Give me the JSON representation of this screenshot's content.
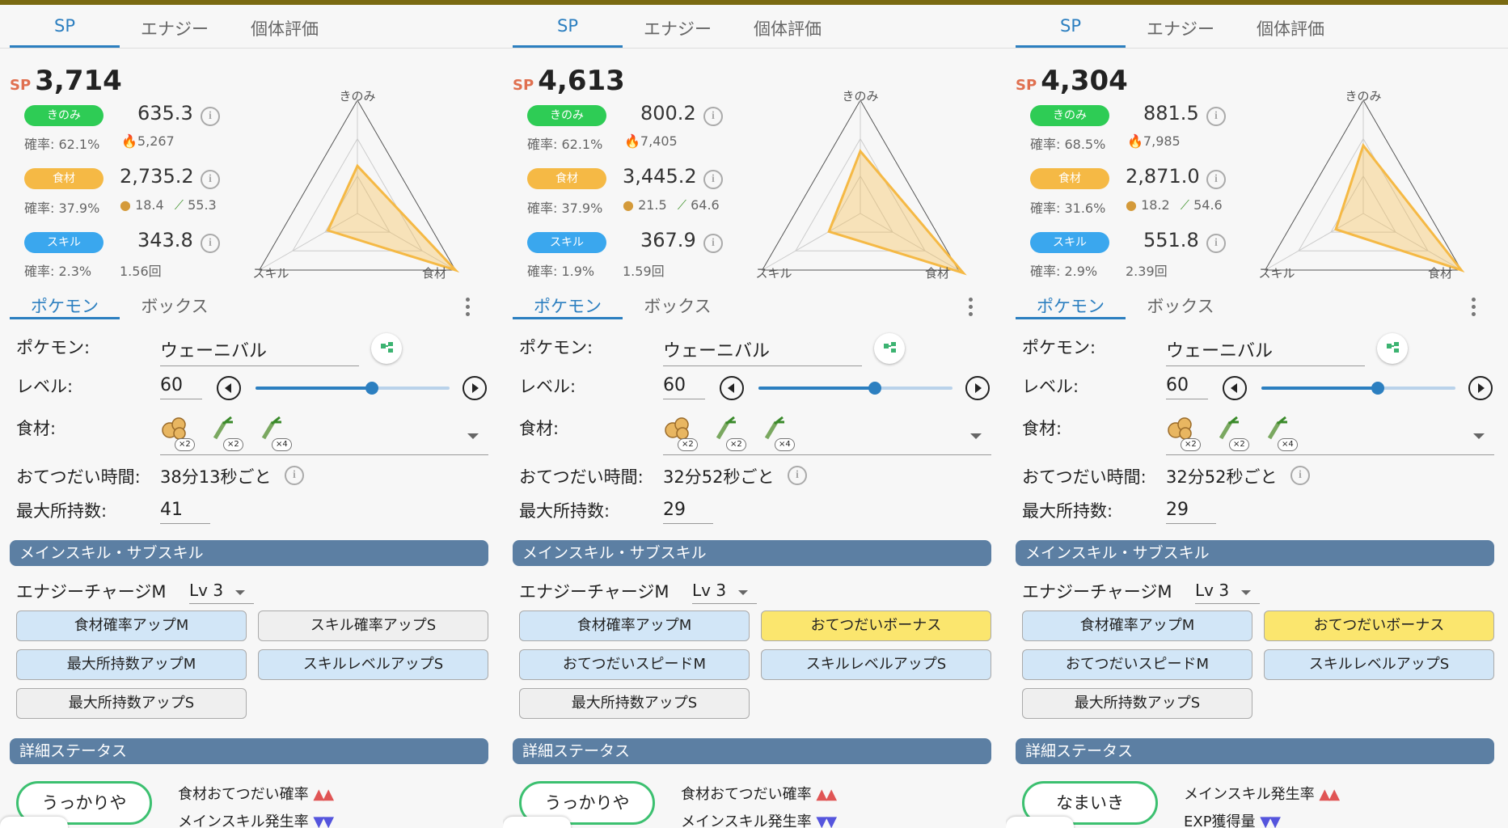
{
  "tabs": [
    "SP",
    "エナジー",
    "個体評価"
  ],
  "sp_prefix": "SP",
  "labels": {
    "berry_pill": "きのみ",
    "ing_pill": "食材",
    "skill_pill": "スキル",
    "info": "i",
    "radar_top": "きのみ",
    "radar_left": "スキル",
    "radar_right": "食材",
    "sub_tabs": [
      "ポケモン",
      "ボックス"
    ],
    "pokemon": "ポケモン:",
    "level": "レベル:",
    "ingredients": "食材:",
    "help_time": "おてつだい時間:",
    "max_carry": "最大所持数:",
    "skill_section": "メインスキル・サブスキル",
    "detail_section": "詳細ステータス"
  },
  "panels": [
    {
      "sp": "3,714",
      "berry": {
        "value": "635.3",
        "rate": "確率: 62.1%",
        "extra": "5,267"
      },
      "ingredient": {
        "value": "2,735.2",
        "rate": "確率: 37.9%",
        "a": "18.4",
        "b": "55.3"
      },
      "skill": {
        "value": "343.8",
        "rate": "確率: 2.3%",
        "count": "1.56回"
      },
      "radar": {
        "berry": 0.42,
        "ingredient": 1.0,
        "skill": 0.3
      },
      "pokemon_name": "ウェーニバル",
      "level": "60",
      "level_fraction": 0.6,
      "ing_badges": [
        "×2",
        "×2",
        "×4"
      ],
      "help_time": "38分13秒ごと",
      "max_carry": "41",
      "main_skill": "エナジーチャージM",
      "skill_level": "Lv 3",
      "subskills": [
        {
          "label": "食材確率アップM",
          "color": "blue"
        },
        {
          "label": "スキル確率アップS",
          "color": "gray"
        },
        {
          "label": "最大所持数アップM",
          "color": "blue"
        },
        {
          "label": "スキルレベルアップS",
          "color": "blue"
        },
        {
          "label": "最大所持数アップS",
          "color": "gray"
        }
      ],
      "nature": "うっかりや",
      "detail1": {
        "text": "食材おてつだい確率",
        "arrows": "▲▲",
        "dir": "up"
      },
      "detail2": {
        "text": "メインスキル発生率",
        "arrows": "▼▼",
        "dir": "down"
      }
    },
    {
      "sp": "4,613",
      "berry": {
        "value": "800.2",
        "rate": "確率: 62.1%",
        "extra": "7,405"
      },
      "ingredient": {
        "value": "3,445.2",
        "rate": "確率: 37.9%",
        "a": "21.5",
        "b": "64.6"
      },
      "skill": {
        "value": "367.9",
        "rate": "確率: 1.9%",
        "count": "1.59回"
      },
      "radar": {
        "berry": 0.55,
        "ingredient": 1.05,
        "skill": 0.32
      },
      "pokemon_name": "ウェーニバル",
      "level": "60",
      "level_fraction": 0.6,
      "ing_badges": [
        "×2",
        "×2",
        "×4"
      ],
      "help_time": "32分52秒ごと",
      "max_carry": "29",
      "main_skill": "エナジーチャージM",
      "skill_level": "Lv 3",
      "subskills": [
        {
          "label": "食材確率アップM",
          "color": "blue"
        },
        {
          "label": "おてつだいボーナス",
          "color": "gold"
        },
        {
          "label": "おてつだいスピードM",
          "color": "blue"
        },
        {
          "label": "スキルレベルアップS",
          "color": "blue"
        },
        {
          "label": "最大所持数アップS",
          "color": "gray"
        }
      ],
      "nature": "うっかりや",
      "detail1": {
        "text": "食材おてつだい確率",
        "arrows": "▲▲",
        "dir": "up"
      },
      "detail2": {
        "text": "メインスキル発生率",
        "arrows": "▼▼",
        "dir": "down"
      }
    },
    {
      "sp": "4,304",
      "berry": {
        "value": "881.5",
        "rate": "確率: 68.5%",
        "extra": "7,985"
      },
      "ingredient": {
        "value": "2,871.0",
        "rate": "確率: 31.6%",
        "a": "18.2",
        "b": "54.6"
      },
      "skill": {
        "value": "551.8",
        "rate": "確率: 2.9%",
        "count": "2.39回"
      },
      "radar": {
        "berry": 0.6,
        "ingredient": 1.0,
        "skill": 0.28
      },
      "pokemon_name": "ウェーニバル",
      "level": "60",
      "level_fraction": 0.6,
      "ing_badges": [
        "×2",
        "×2",
        "×4"
      ],
      "help_time": "32分52秒ごと",
      "max_carry": "29",
      "main_skill": "エナジーチャージM",
      "skill_level": "Lv 3",
      "subskills": [
        {
          "label": "食材確率アップM",
          "color": "blue"
        },
        {
          "label": "おてつだいボーナス",
          "color": "gold"
        },
        {
          "label": "おてつだいスピードM",
          "color": "blue"
        },
        {
          "label": "スキルレベルアップS",
          "color": "blue"
        },
        {
          "label": "最大所持数アップS",
          "color": "gray"
        }
      ],
      "nature": "なまいき",
      "detail1": {
        "text": "メインスキル発生率",
        "arrows": "▲▲",
        "dir": "up"
      },
      "detail2": {
        "text": "EXP獲得量",
        "arrows": "▼▼",
        "dir": "down"
      }
    }
  ]
}
